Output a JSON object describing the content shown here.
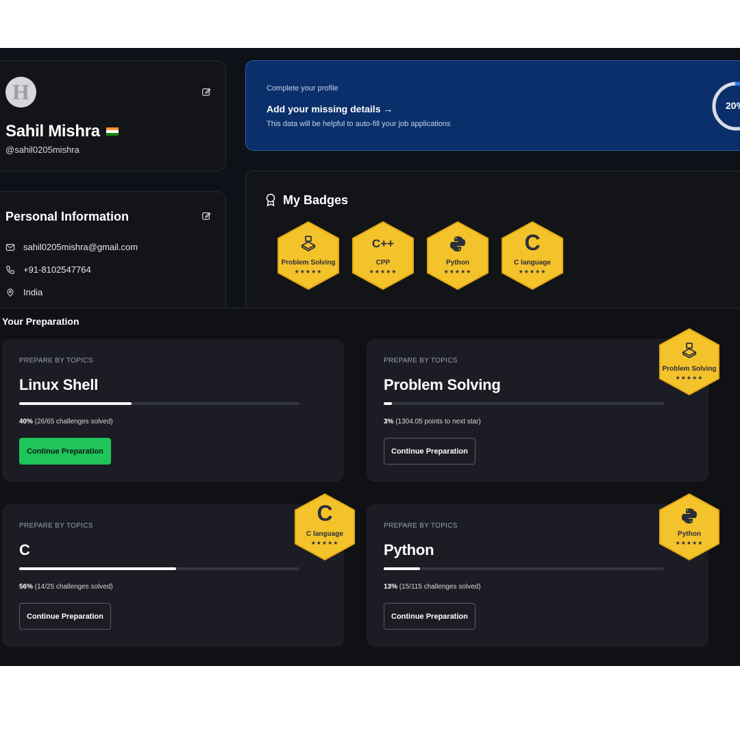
{
  "profile": {
    "avatar_letter": "H",
    "name": "Sahil Mishra",
    "handle": "@sahil0205mishra",
    "flag_colors": [
      "#ff9933",
      "#ffffff",
      "#138808"
    ]
  },
  "personal_info": {
    "title": "Personal Information",
    "email": "sahil0205mishra@gmail.com",
    "phone": "+91-8102547764",
    "location": "India"
  },
  "complete_profile": {
    "overline": "Complete your profile",
    "title": "Add your missing details →",
    "subtitle": "This data will be helpful to auto-fill your job applications",
    "percent_text": "20%",
    "percent": 20
  },
  "badges": {
    "title": "My Badges",
    "items": [
      {
        "label": "Problem Solving",
        "icon": "console-icon",
        "stars": "★★★★★"
      },
      {
        "label": "CPP",
        "icon": "cpp-icon",
        "glyph": "C++",
        "stars": "★★★★★"
      },
      {
        "label": "Python",
        "icon": "python-icon",
        "stars": "★★★★★"
      },
      {
        "label": "C language",
        "icon": "c-icon",
        "glyph": "C",
        "stars": "★★★★★"
      }
    ]
  },
  "preparation": {
    "heading": "Your Preparation",
    "cards": [
      {
        "overline": "PREPARE BY TOPICS",
        "title": "Linux Shell",
        "progress": 0.4,
        "stat_bold": "40%",
        "stat_rest": " (26/65 challenges solved)",
        "button": "Continue Preparation"
      },
      {
        "overline": "PREPARE BY TOPICS",
        "title": "Problem Solving",
        "progress": 0.03,
        "stat_bold": "3%",
        "stat_rest": " (1304.05 points to next star)",
        "button": "Continue Preparation",
        "badge": {
          "label": "Problem Solving",
          "stars": "★★★★★"
        }
      },
      {
        "overline": "PREPARE BY TOPICS",
        "title": "C",
        "progress": 0.56,
        "stat_bold": "56%",
        "stat_rest": " (14/25 challenges solved)",
        "button": "Continue Preparation",
        "badge": {
          "label": "C language",
          "glyph": "C",
          "stars": "★★★★★"
        }
      },
      {
        "overline": "PREPARE BY TOPICS",
        "title": "Python",
        "progress": 0.13,
        "stat_bold": "13%",
        "stat_rest": " (15/115 challenges solved)",
        "button": "Continue Preparation",
        "badge": {
          "label": "Python",
          "stars": "★★★★★"
        }
      }
    ]
  },
  "colors": {
    "badge_gold": "#f4c22b",
    "badge_gold_dark": "#e0a812",
    "primary_button": "#1fc55b",
    "banner_bg": "#0a2f6b",
    "ring_accent": "#2f7df6"
  }
}
